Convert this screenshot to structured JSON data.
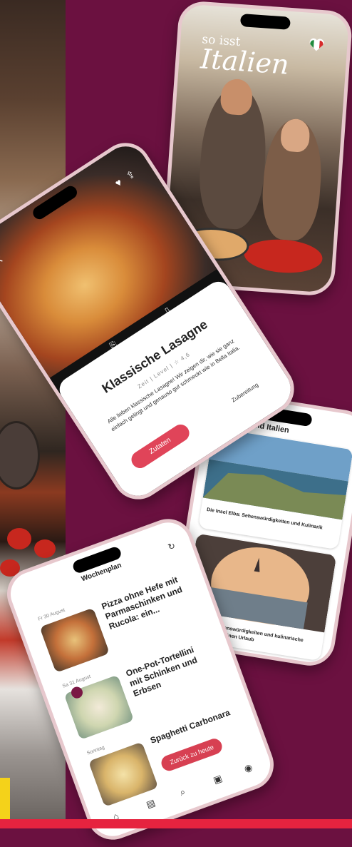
{
  "brand": {
    "line1": "so isst",
    "line2": "Italien"
  },
  "recipe": {
    "title": "Klassische Lasagne",
    "meta": "Zeit  |  Level  |  ☆ 4,6",
    "description": "Alle lieben klassische Lasagne! Wir zeigen dir, wie sie ganz einfach gelingt und genauso gut schmeckt wie in Bella Italia.",
    "button": "Zutaten",
    "link": "Zubereitung",
    "tab1": "Speichern",
    "tab2": "Kochmodus"
  },
  "reise": {
    "title": "Reiseland Italien",
    "card1": "Die Insel Elba: Sehenswürdigkeiten und Kulinarik",
    "card2": "Venedig: 8 Sehenswürdigkeiten und kulinarische Highlights für deinen Urlaub"
  },
  "woche": {
    "title": "Wochenplan",
    "days": [
      "Fr 30 August",
      "Sa 31 August",
      "Sonntag"
    ],
    "items": [
      "Pizza ohne Hefe mit Parmaschinken und Rucola: ein...",
      "One-Pot-Tortellini mit Schinken und Erbsen",
      "Spaghetti Carbonara"
    ],
    "button": "Zurück zu heute"
  },
  "colors": {
    "background": "#6b1140",
    "accent": "#e04459",
    "bottom_bar": "#e6233f"
  }
}
